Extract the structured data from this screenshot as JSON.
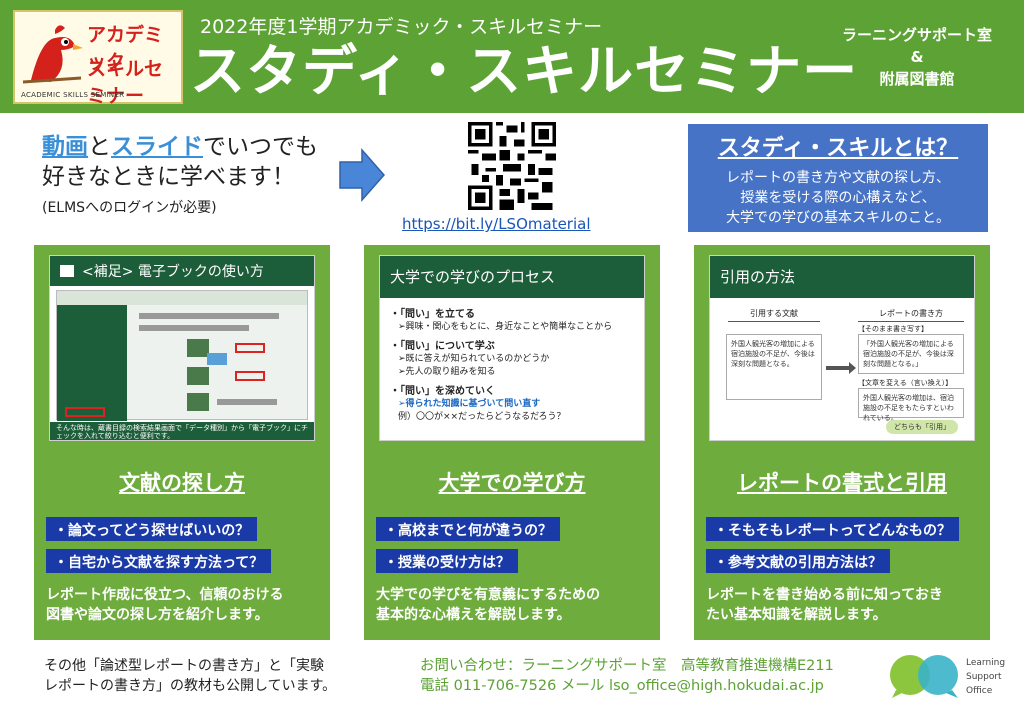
{
  "header": {
    "logo_line1": "アカデミック",
    "logo_line2": "スキルセミナー",
    "logo_line3": "ACADEMIC SKILLS SEMINER",
    "subtitle": "2022年度1学期アカデミック・スキルセミナー",
    "title": "スタディ・スキルセミナー",
    "org_line1": "ラーニングサポート室",
    "org_line2": "&",
    "org_line3": "附属図書館"
  },
  "intro": {
    "hl1": "動画",
    "t1": "と",
    "hl2": "スライド",
    "t2": "でいつでも",
    "line2": "好きなときに学べます！",
    "note": "(ELMSへのログインが必要)"
  },
  "qr": {
    "link": "https://bit.ly/LSOmaterial"
  },
  "what": {
    "title": "スタディ・スキルとは？",
    "line1": "レポートの書き方や文献の探し方、",
    "line2": "授業を受ける際の心構えなど、",
    "line3": "大学での学びの基本スキルのこと。"
  },
  "cards": [
    {
      "slide_title": "<補足> 電子ブックの使い方",
      "slide_caption": "そんな時は、蔵書目録の検索結果画面で「データ種別」から「電子ブック」にチェックを入れて絞り込むと便利です。",
      "title": "文献の探し方",
      "q1": "・論文ってどう探せばいいの？",
      "q2": "・自宅から文献を探す方法って？",
      "desc_line1": "レポート作成に役立つ、信頼のおける",
      "desc_line2": "図書や論文の探し方を紹介します。"
    },
    {
      "slide_title": "大学での学びのプロセス",
      "slide_l1": "・「問い」を立てる",
      "slide_l1a": "➢興味・関心をもとに、身近なことや簡単なことから",
      "slide_l2": "・「問い」について学ぶ",
      "slide_l2a": "➢既に答えが知られているのかどうか",
      "slide_l2b": "➢先人の取り組みを知る",
      "slide_l3": "・「問い」を深めていく",
      "slide_l3a": "➢得られた知識に基づいて問い直す",
      "slide_l3b": "例）〇〇が××だったらどうなるだろう？",
      "title": "大学での学び方",
      "q1": "・高校までと何が違うの？",
      "q2": "・授業の受け方は？",
      "desc_line1": "大学での学びを有意義にするための",
      "desc_line2": "基本的な心構えを解説します。"
    },
    {
      "slide_title": "引用の方法",
      "slide_col1": "引用する文献",
      "slide_col2": "レポートの書き方",
      "slide_src": "外国人観光客の増加による宿泊施設の不足が、今後は深刻な問題となる。",
      "slide_r1h": "【そのまま書き写す】",
      "slide_r1": "「外国人観光客の増加による宿泊施設の不足が、今後は深刻な問題となる。」",
      "slide_r2h": "【文章を変える（言い換え）】",
      "slide_r2": "外国人観光客の増加は、宿泊施設の不足をもたらすといわれている。",
      "slide_bubble": "どちらも「引用」",
      "title": "レポートの書式と引用",
      "q1": "・そもそもレポートってどんなもの？",
      "q2": "・参考文献の引用方法は？",
      "desc_line1": "レポートを書き始める前に知っておき",
      "desc_line2": "たい基本知識を解説します。"
    }
  ],
  "footer": {
    "left_line1": "その他「論述型レポートの書き方」と「実験",
    "left_line2": "レポートの書き方」の教材も公開しています。",
    "contact_line1": "お問い合わせ：ラーニングサポート室　高等教育推進機構E211",
    "contact_line2": "電話 011-706-7526 メール lso_office@high.hokudai.ac.jp",
    "lso_line1": "Learning",
    "lso_line2": "Support",
    "lso_line3": "Office"
  },
  "colors": {
    "header_green": "#5ca234",
    "card_green": "#6fac3e",
    "slide_header": "#1d5e3a",
    "question_blue": "#1a3aa8",
    "what_blue": "#4773c6",
    "link_blue": "#1a55b8"
  },
  "icons": [
    "bird-mascot-icon",
    "right-arrow-icon",
    "qr-code-icon",
    "book-icon",
    "lso-logo-icon"
  ]
}
